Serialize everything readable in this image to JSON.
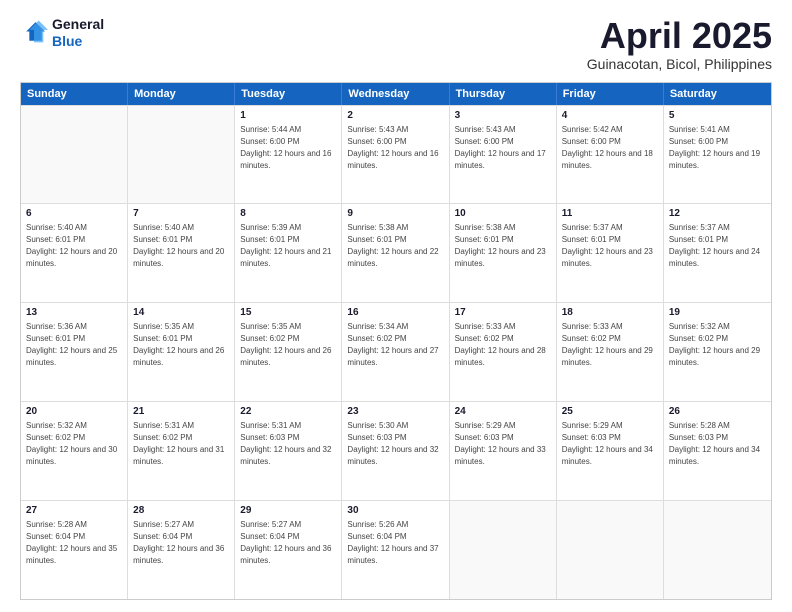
{
  "header": {
    "logo_general": "General",
    "logo_blue": "Blue",
    "title": "April 2025",
    "subtitle": "Guinacotan, Bicol, Philippines"
  },
  "calendar": {
    "days": [
      "Sunday",
      "Monday",
      "Tuesday",
      "Wednesday",
      "Thursday",
      "Friday",
      "Saturday"
    ],
    "rows": [
      [
        {
          "day": "",
          "info": ""
        },
        {
          "day": "",
          "info": ""
        },
        {
          "day": "1",
          "info": "Sunrise: 5:44 AM\nSunset: 6:00 PM\nDaylight: 12 hours and 16 minutes."
        },
        {
          "day": "2",
          "info": "Sunrise: 5:43 AM\nSunset: 6:00 PM\nDaylight: 12 hours and 16 minutes."
        },
        {
          "day": "3",
          "info": "Sunrise: 5:43 AM\nSunset: 6:00 PM\nDaylight: 12 hours and 17 minutes."
        },
        {
          "day": "4",
          "info": "Sunrise: 5:42 AM\nSunset: 6:00 PM\nDaylight: 12 hours and 18 minutes."
        },
        {
          "day": "5",
          "info": "Sunrise: 5:41 AM\nSunset: 6:00 PM\nDaylight: 12 hours and 19 minutes."
        }
      ],
      [
        {
          "day": "6",
          "info": "Sunrise: 5:40 AM\nSunset: 6:01 PM\nDaylight: 12 hours and 20 minutes."
        },
        {
          "day": "7",
          "info": "Sunrise: 5:40 AM\nSunset: 6:01 PM\nDaylight: 12 hours and 20 minutes."
        },
        {
          "day": "8",
          "info": "Sunrise: 5:39 AM\nSunset: 6:01 PM\nDaylight: 12 hours and 21 minutes."
        },
        {
          "day": "9",
          "info": "Sunrise: 5:38 AM\nSunset: 6:01 PM\nDaylight: 12 hours and 22 minutes."
        },
        {
          "day": "10",
          "info": "Sunrise: 5:38 AM\nSunset: 6:01 PM\nDaylight: 12 hours and 23 minutes."
        },
        {
          "day": "11",
          "info": "Sunrise: 5:37 AM\nSunset: 6:01 PM\nDaylight: 12 hours and 23 minutes."
        },
        {
          "day": "12",
          "info": "Sunrise: 5:37 AM\nSunset: 6:01 PM\nDaylight: 12 hours and 24 minutes."
        }
      ],
      [
        {
          "day": "13",
          "info": "Sunrise: 5:36 AM\nSunset: 6:01 PM\nDaylight: 12 hours and 25 minutes."
        },
        {
          "day": "14",
          "info": "Sunrise: 5:35 AM\nSunset: 6:01 PM\nDaylight: 12 hours and 26 minutes."
        },
        {
          "day": "15",
          "info": "Sunrise: 5:35 AM\nSunset: 6:02 PM\nDaylight: 12 hours and 26 minutes."
        },
        {
          "day": "16",
          "info": "Sunrise: 5:34 AM\nSunset: 6:02 PM\nDaylight: 12 hours and 27 minutes."
        },
        {
          "day": "17",
          "info": "Sunrise: 5:33 AM\nSunset: 6:02 PM\nDaylight: 12 hours and 28 minutes."
        },
        {
          "day": "18",
          "info": "Sunrise: 5:33 AM\nSunset: 6:02 PM\nDaylight: 12 hours and 29 minutes."
        },
        {
          "day": "19",
          "info": "Sunrise: 5:32 AM\nSunset: 6:02 PM\nDaylight: 12 hours and 29 minutes."
        }
      ],
      [
        {
          "day": "20",
          "info": "Sunrise: 5:32 AM\nSunset: 6:02 PM\nDaylight: 12 hours and 30 minutes."
        },
        {
          "day": "21",
          "info": "Sunrise: 5:31 AM\nSunset: 6:02 PM\nDaylight: 12 hours and 31 minutes."
        },
        {
          "day": "22",
          "info": "Sunrise: 5:31 AM\nSunset: 6:03 PM\nDaylight: 12 hours and 32 minutes."
        },
        {
          "day": "23",
          "info": "Sunrise: 5:30 AM\nSunset: 6:03 PM\nDaylight: 12 hours and 32 minutes."
        },
        {
          "day": "24",
          "info": "Sunrise: 5:29 AM\nSunset: 6:03 PM\nDaylight: 12 hours and 33 minutes."
        },
        {
          "day": "25",
          "info": "Sunrise: 5:29 AM\nSunset: 6:03 PM\nDaylight: 12 hours and 34 minutes."
        },
        {
          "day": "26",
          "info": "Sunrise: 5:28 AM\nSunset: 6:03 PM\nDaylight: 12 hours and 34 minutes."
        }
      ],
      [
        {
          "day": "27",
          "info": "Sunrise: 5:28 AM\nSunset: 6:04 PM\nDaylight: 12 hours and 35 minutes."
        },
        {
          "day": "28",
          "info": "Sunrise: 5:27 AM\nSunset: 6:04 PM\nDaylight: 12 hours and 36 minutes."
        },
        {
          "day": "29",
          "info": "Sunrise: 5:27 AM\nSunset: 6:04 PM\nDaylight: 12 hours and 36 minutes."
        },
        {
          "day": "30",
          "info": "Sunrise: 5:26 AM\nSunset: 6:04 PM\nDaylight: 12 hours and 37 minutes."
        },
        {
          "day": "",
          "info": ""
        },
        {
          "day": "",
          "info": ""
        },
        {
          "day": "",
          "info": ""
        }
      ]
    ]
  }
}
